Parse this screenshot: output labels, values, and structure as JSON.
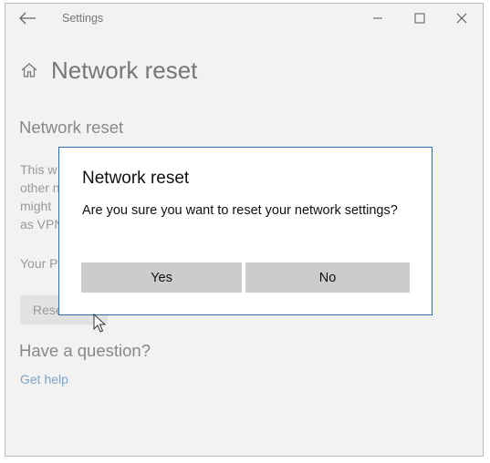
{
  "window": {
    "app_title": "Settings",
    "controls": {
      "back": "back-arrow-icon",
      "minimize": "minimize-icon",
      "maximize": "maximize-icon",
      "close": "close-icon"
    }
  },
  "page": {
    "home_icon": "home-icon",
    "title": "Network reset",
    "section_title": "Network reset",
    "description_visible_lines": [
      "This w",
      "other n",
      "might",
      "as VPN"
    ],
    "note_partial": "Your P",
    "reset_button_partial": "Rese",
    "help_title": "Have a question?",
    "help_link": "Get help"
  },
  "dialog": {
    "title": "Network reset",
    "message": "Are you sure you want to reset your network settings?",
    "yes_label": "Yes",
    "no_label": "No"
  },
  "colors": {
    "dialog_border": "#2a6fb3",
    "link": "#7fa6c9",
    "dialog_button": "#cccccc",
    "window_background": "#f2f2f2"
  }
}
